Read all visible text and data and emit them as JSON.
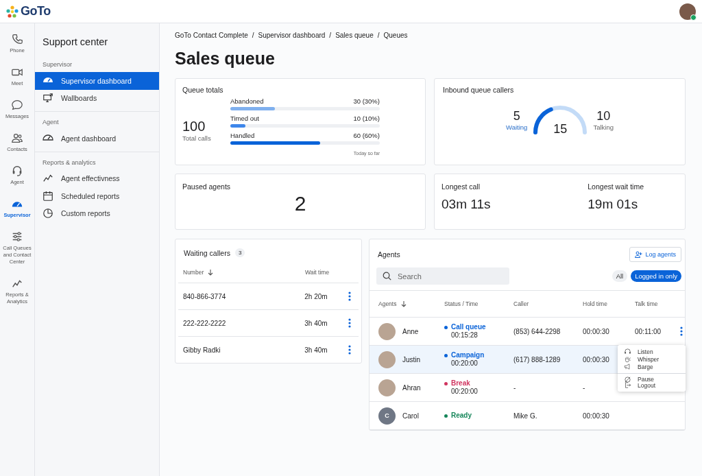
{
  "top_bar": {
    "logo": "GoTo"
  },
  "rail": [
    {
      "label": "Phone",
      "selected": false
    },
    {
      "label": "Meet",
      "selected": false
    },
    {
      "label": "Messages",
      "selected": false
    },
    {
      "label": "Contacts",
      "selected": false
    },
    {
      "label": "Agent",
      "selected": false
    },
    {
      "label": "Supervisor",
      "selected": true
    },
    {
      "label": "Call Queues and Contact Center",
      "selected": false
    },
    {
      "label": "Reports & Analytics",
      "selected": false
    }
  ],
  "sidebar": {
    "title": "Support center",
    "sections": [
      {
        "heading": "Supervisor",
        "items": [
          {
            "label": "Supervisor dashboard",
            "selected": true
          },
          {
            "label": "Wallboards",
            "selected": false
          }
        ]
      },
      {
        "heading": "Agent",
        "items": [
          {
            "label": "Agent dashboard",
            "selected": false
          }
        ]
      },
      {
        "heading": "Reports & analytics",
        "items": [
          {
            "label": "Agent effectivness",
            "selected": false
          },
          {
            "label": "Scheduled reports",
            "selected": false
          },
          {
            "label": "Custom reports",
            "selected": false
          }
        ]
      }
    ]
  },
  "breadcrumb": {
    "separator": "/",
    "items": [
      "GoTo Contact Complete",
      "Supervisor dashboard",
      "Sales queue",
      "Queues"
    ]
  },
  "page_title": "Sales queue",
  "queue_totals": {
    "title": "Queue totals",
    "total": "100",
    "total_label": "Total calls",
    "footnote": "Today so far",
    "bars": [
      {
        "label": "Abandoned",
        "reading": "30 (30%)",
        "level": 0.3,
        "color": "#7fb0ee"
      },
      {
        "label": "Timed out",
        "reading": "10 (10%)",
        "level": 0.1,
        "color": "#3d86ea"
      },
      {
        "label": "Handled",
        "reading": "60 (60%)",
        "level": 0.6,
        "color": "#0a63d8"
      }
    ]
  },
  "inbound": {
    "title": "Inbound queue callers",
    "waiting": "5",
    "waiting_label": "Waiting",
    "total": "15",
    "talking": "10",
    "talking_label": "Talking",
    "level": 0.33
  },
  "paused_agents": {
    "title": "Paused agents",
    "value": "2"
  },
  "longest": [
    {
      "label": "Longest call",
      "value": "03m 11s"
    },
    {
      "label": "Longest wait time",
      "value": "19m 01s"
    }
  ],
  "waiting_callers": {
    "title": "Waiting callers",
    "count": "3",
    "columns": [
      "Number",
      "Wait time"
    ],
    "rows": [
      {
        "number": "840-866-3774",
        "wait": "2h 20m"
      },
      {
        "number": "222-222-2222",
        "wait": "3h 40m"
      },
      {
        "number": "Gibby Radki",
        "wait": "3h 40m"
      }
    ]
  },
  "agents": {
    "title": "Agents",
    "log_button": "Log agents",
    "search": {
      "placeholder": "Search"
    },
    "filters": [
      {
        "label": "All",
        "selected": false
      },
      {
        "label": "Logged in only",
        "selected": true
      }
    ],
    "columns": [
      "Agents",
      "Status / Time",
      "Caller",
      "Hold time",
      "Talk time"
    ],
    "rows": [
      {
        "kind": "photo",
        "name": "Anne",
        "status": "Call queue",
        "color": "#0a63d8",
        "time": "00:15:28",
        "caller": "(853) 644-2298",
        "hold": "00:00:30",
        "talk": "00:11:00",
        "selected": false,
        "menu_button": true
      },
      {
        "kind": "photo",
        "name": "Justin",
        "status": "Campaign",
        "color": "#0a63d8",
        "time": "00:20:00",
        "caller": "(617) 888-1289",
        "hold": "00:00:30",
        "selected": true,
        "menu_button": false
      },
      {
        "kind": "photo",
        "name": "Ahran",
        "status": "Break",
        "color": "#d0345f",
        "time": "00:20:00",
        "caller": "-",
        "hold": "-",
        "selected": false,
        "menu_button": false
      },
      {
        "kind": "initial",
        "initial": "C",
        "name": "Carol",
        "status": "Ready",
        "color": "#16865a",
        "caller": "Mike G.",
        "hold": "00:00:30",
        "selected": false,
        "menu_button": false
      }
    ],
    "menu": [
      {
        "label": "Listen",
        "divider_before": false
      },
      {
        "label": "Whisper",
        "divider_before": false
      },
      {
        "label": "Barge",
        "divider_before": false
      },
      {
        "label": "Pause",
        "divider_before": true
      },
      {
        "label": "Logout",
        "divider_before": false
      }
    ]
  }
}
